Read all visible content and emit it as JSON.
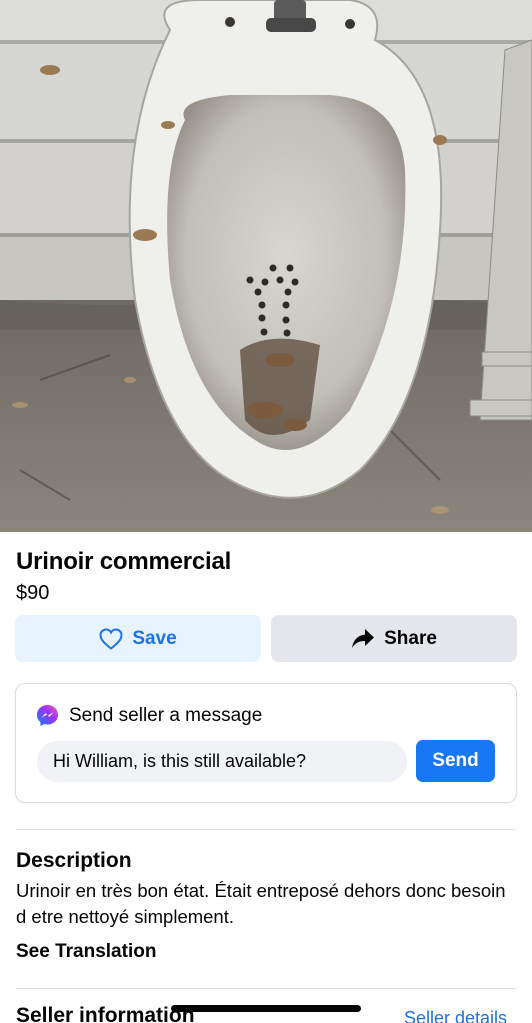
{
  "listing": {
    "title": "Urinoir commercial",
    "price": "$90",
    "photo_icon": "urinal-photo"
  },
  "actions": {
    "save_label": "Save",
    "save_icon": "heart-icon",
    "share_label": "Share",
    "share_icon": "share-arrow-icon"
  },
  "message": {
    "heading": "Send seller a message",
    "heading_icon": "messenger-icon",
    "input_value": "Hi William, is this still available?",
    "send_label": "Send"
  },
  "description": {
    "heading": "Description",
    "text": "Urinoir  en très bon état. Était entreposé dehors donc besoin d etre nettoyé simplement.",
    "translate_label": "See Translation"
  },
  "seller": {
    "heading": "Seller information",
    "details_link": "Seller details"
  },
  "colors": {
    "accent": "#1877f2",
    "link": "#1b74e4",
    "save_bg": "#e7f3ff",
    "share_bg": "#e4e6eb"
  }
}
